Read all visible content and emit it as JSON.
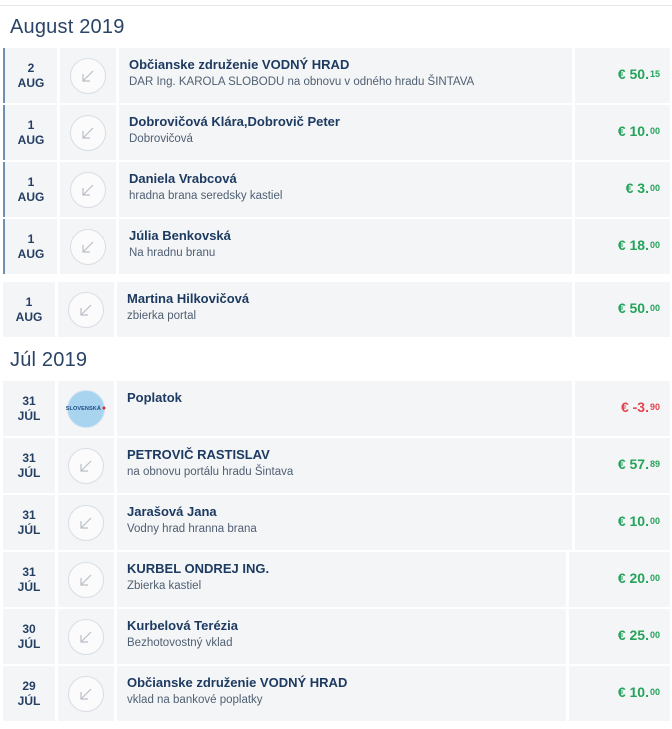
{
  "colors": {
    "positive": "#25a35a",
    "negative": "#e0464f",
    "text": "#1d3a61"
  },
  "groups": [
    {
      "month": "August 2019",
      "transactions": [
        {
          "day": "2",
          "mon": "AUG",
          "name": "Občianske združenie VODNÝ HRAD",
          "desc": "DAR Ing. KAROLA SLOBODU na obnovu v odného hradu ŠINTAVA",
          "currency": "€",
          "main": "50",
          "cents": "15"
        },
        {
          "day": "1",
          "mon": "AUG",
          "name": "Dobrovičová Klára,Dobrovič Peter",
          "desc": "Dobrovičová",
          "currency": "€",
          "main": "10",
          "cents": "00"
        },
        {
          "day": "1",
          "mon": "AUG",
          "name": "Daniela Vrabcová",
          "desc": "hradna brana seredsky kastiel",
          "currency": "€",
          "main": "3",
          "cents": "00"
        },
        {
          "day": "1",
          "mon": "AUG",
          "name": "Júlia Benkovská",
          "desc": "Na hradnu branu",
          "currency": "€",
          "main": "18",
          "cents": "00"
        },
        {
          "day": "1",
          "mon": "AUG",
          "name": "Martina Hilkovičová",
          "desc": "zbierka portal",
          "currency": "€",
          "main": "50",
          "cents": "00"
        }
      ]
    },
    {
      "month": "Júl 2019",
      "transactions": [
        {
          "day": "31",
          "mon": "JÚL",
          "name": "Poplatok",
          "desc": "",
          "currency": "€",
          "main": "-3",
          "cents": "90",
          "bank_logo": "SLOVENSKÁ"
        },
        {
          "day": "31",
          "mon": "JÚL",
          "name": "PETROVIČ RASTISLAV",
          "desc": "na obnovu portálu hradu Šintava",
          "currency": "€",
          "main": "57",
          "cents": "89"
        },
        {
          "day": "31",
          "mon": "JÚL",
          "name": "Jarašová Jana",
          "desc": "Vodny hrad hranna brana",
          "currency": "€",
          "main": "10",
          "cents": "00"
        },
        {
          "day": "31",
          "mon": "JÚL",
          "name": "KURBEL ONDREJ ING.",
          "desc": "Zbierka kastiel",
          "currency": "€",
          "main": "20",
          "cents": "00"
        },
        {
          "day": "30",
          "mon": "JÚL",
          "name": "Kurbelová Terézia",
          "desc": "Bezhotovostný vklad",
          "currency": "€",
          "main": "25",
          "cents": "00"
        },
        {
          "day": "29",
          "mon": "JÚL",
          "name": "Občianske združenie VODNÝ HRAD",
          "desc": "vklad na bankové poplatky",
          "currency": "€",
          "main": "10",
          "cents": "00"
        }
      ]
    }
  ]
}
